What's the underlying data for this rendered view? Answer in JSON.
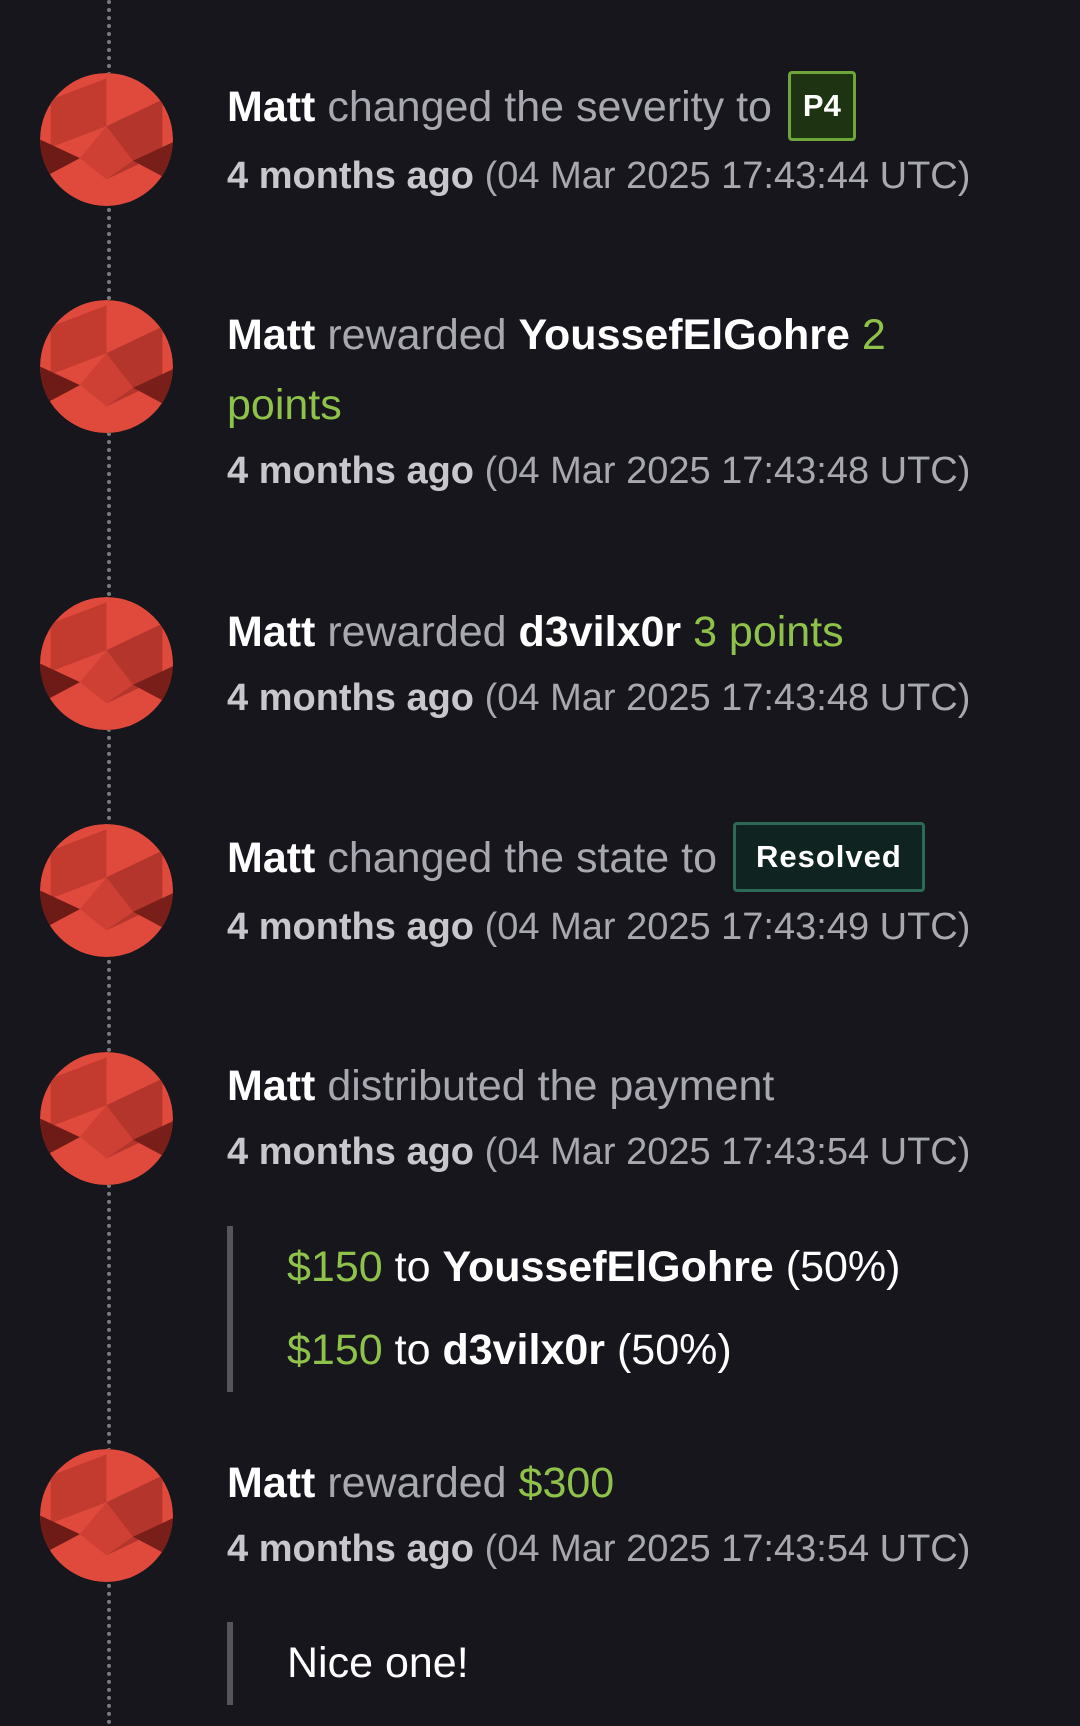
{
  "events": [
    {
      "actor": "Matt",
      "text": "changed the severity to",
      "badge": "P4",
      "relative": "4 months ago",
      "timestamp": "(04 Mar 2025 17:43:44 UTC)"
    },
    {
      "actor": "Matt",
      "text": "rewarded",
      "target": "YoussefElGohre",
      "points_num": "2",
      "points_word": "points",
      "relative": "4 months ago",
      "timestamp": "(04 Mar 2025 17:43:48 UTC)"
    },
    {
      "actor": "Matt",
      "text": "rewarded",
      "target": "d3vilx0r",
      "points": "3 points",
      "relative": "4 months ago",
      "timestamp": "(04 Mar 2025 17:43:48 UTC)"
    },
    {
      "actor": "Matt",
      "text": "changed the state to",
      "badge": "Resolved",
      "relative": "4 months ago",
      "timestamp": "(04 Mar 2025 17:43:49 UTC)"
    },
    {
      "actor": "Matt",
      "text": "distributed the payment",
      "relative": "4 months ago",
      "timestamp": "(04 Mar 2025 17:43:54 UTC)",
      "payments": [
        {
          "amount": "$150",
          "to": "to",
          "user": "YoussefElGohre",
          "share": "(50%)"
        },
        {
          "amount": "$150",
          "to": "to",
          "user": "d3vilx0r",
          "share": "(50%)"
        }
      ]
    },
    {
      "actor": "Matt",
      "text": "rewarded",
      "amount": "$300",
      "relative": "4 months ago",
      "timestamp": "(04 Mar 2025 17:43:54 UTC)",
      "comment": "Nice one!"
    }
  ],
  "colors": {
    "background": "#16161c",
    "accent_green": "#8fc24a",
    "avatar_red": "#e04a3c",
    "p4_border": "#6ea53a",
    "resolved_border": "#2d6a55"
  },
  "icons": {
    "avatar": "geometric-avatar-icon"
  }
}
